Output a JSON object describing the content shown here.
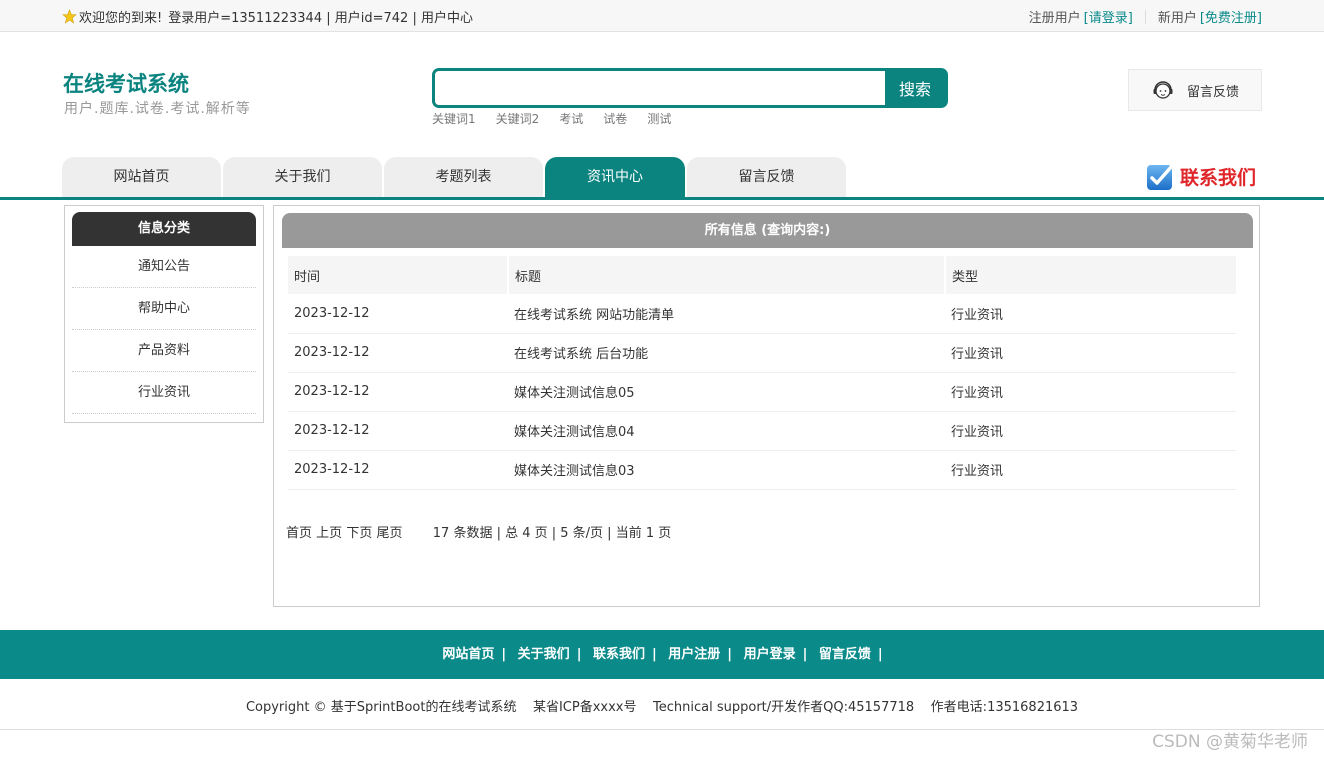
{
  "topbar": {
    "welcome": "欢迎您的到来!",
    "user_info": "登录用户=13511223344 | 用户id=742 | 用户中心",
    "reg_user_label": "注册用户",
    "login_link": "[请登录]",
    "new_user_label": "新用户",
    "register_link": "[免费注册]"
  },
  "header": {
    "site_title": "在线考试系统",
    "subtitle": "用户.题库.试卷.考试.解析等",
    "search_placeholder": "",
    "search_button": "搜索",
    "keywords": [
      "关键词1",
      "关键词2",
      "考试",
      "试卷",
      "测试"
    ],
    "feedback": "留言反馈"
  },
  "nav": {
    "items": [
      {
        "label": "网站首页",
        "active": false
      },
      {
        "label": "关于我们",
        "active": false
      },
      {
        "label": "考题列表",
        "active": false
      },
      {
        "label": "资讯中心",
        "active": true
      },
      {
        "label": "留言反馈",
        "active": false
      }
    ],
    "contact": "联系我们"
  },
  "sidebar": {
    "title": "信息分类",
    "items": [
      "通知公告",
      "帮助中心",
      "产品资料",
      "行业资讯"
    ]
  },
  "main": {
    "title": "所有信息 (查询内容:)",
    "columns": [
      "时间",
      "标题",
      "类型"
    ],
    "rows": [
      [
        "2023-12-12",
        "在线考试系统 网站功能清单",
        "行业资讯"
      ],
      [
        "2023-12-12",
        "在线考试系统 后台功能",
        "行业资讯"
      ],
      [
        "2023-12-12",
        "媒体关注测试信息05",
        "行业资讯"
      ],
      [
        "2023-12-12",
        "媒体关注测试信息04",
        "行业资讯"
      ],
      [
        "2023-12-12",
        "媒体关注测试信息03",
        "行业资讯"
      ]
    ],
    "pager": {
      "first": "首页",
      "prev": "上页",
      "next": "下页",
      "last": "尾页",
      "summary": "17 条数据 | 总 4 页 | 5 条/页 | 当前 1 页"
    }
  },
  "footer": {
    "links": [
      "网站首页",
      "关于我们",
      "联系我们",
      "用户注册",
      "用户登录",
      "留言反馈"
    ],
    "separator": "|",
    "copyright": "Copyright © 基于SprintBoot的在线考试系统    某省ICP备xxxx号    Technical support/开发作者QQ:45157718    作者电话:13516821613"
  },
  "watermark": "CSDN @黄菊华老师",
  "colors": {
    "accent": "#0b8480",
    "contact_red": "#e0262a"
  }
}
